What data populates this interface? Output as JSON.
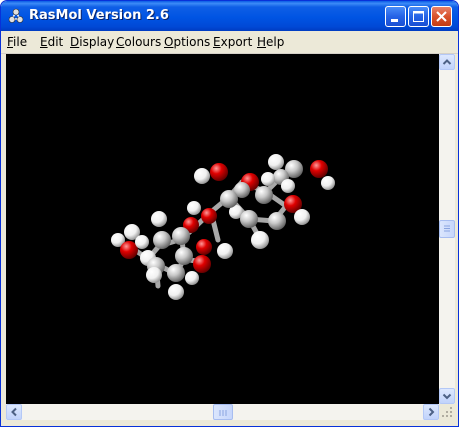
{
  "window": {
    "title": "RasMol Version 2.6",
    "icon": "rasmol-molecule-icon",
    "controls": {
      "minimize_icon": "minimize-icon",
      "maximize_icon": "maximize-icon",
      "close_icon": "close-icon"
    }
  },
  "menu": {
    "items": [
      "File",
      "Edit",
      "Display",
      "Colours",
      "Options",
      "Export",
      "Help"
    ]
  },
  "viewer": {
    "background_color": "#000000",
    "atom_colors": {
      "carbon": "#c8c8c8",
      "oxygen": "#f00000",
      "hydrogen": "#ffffff"
    },
    "rendering": "ball-and-stick"
  },
  "scrollbars": {
    "vertical": {
      "up_icon": "arrow-up-icon",
      "down_icon": "arrow-down-icon",
      "position": 0.5
    },
    "horizontal": {
      "left_icon": "arrow-left-icon",
      "right_icon": "arrow-right-icon",
      "position": 0.5
    }
  }
}
